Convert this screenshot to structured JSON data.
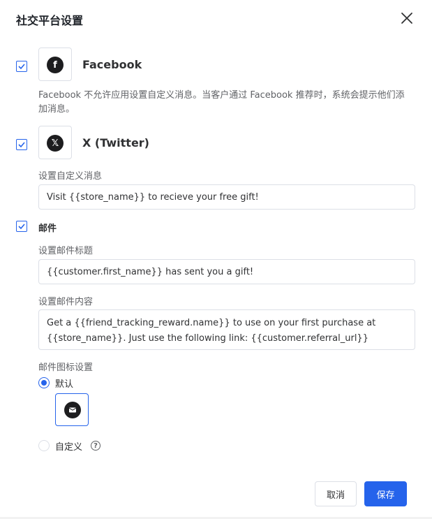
{
  "dialog": {
    "title": "社交平台设置"
  },
  "facebook": {
    "name": "Facebook",
    "icon_letter": "f",
    "checked": true,
    "note": "Facebook 不允许应用设置自定义消息。当客户通过 Facebook 推荐时，系统会提示他们添加消息。"
  },
  "twitter": {
    "name": "X (Twitter)",
    "icon_letter": "𝕏",
    "checked": true,
    "custom_message_label": "设置自定义消息",
    "custom_message_value": "Visit {{store_name}} to recieve your free gift!"
  },
  "email": {
    "section_label": "邮件",
    "checked": true,
    "subject_label": "设置邮件标题",
    "subject_value": "{{customer.first_name}} has sent you a gift!",
    "body_label": "设置邮件内容",
    "body_value": "Get a {{friend_tracking_reward.name}} to use on your first purchase at {{store_name}}. Just use the following link: {{customer.referral_url}}",
    "icon_settings_label": "邮件图标设置",
    "option_default": "默认",
    "option_custom": "自定义",
    "selected_option": "默认"
  },
  "footer": {
    "cancel_label": "取消",
    "save_label": "保存"
  },
  "colors": {
    "accent": "#2563eb",
    "border": "#dcdfe6",
    "icon_dark": "#1d1d1f"
  }
}
